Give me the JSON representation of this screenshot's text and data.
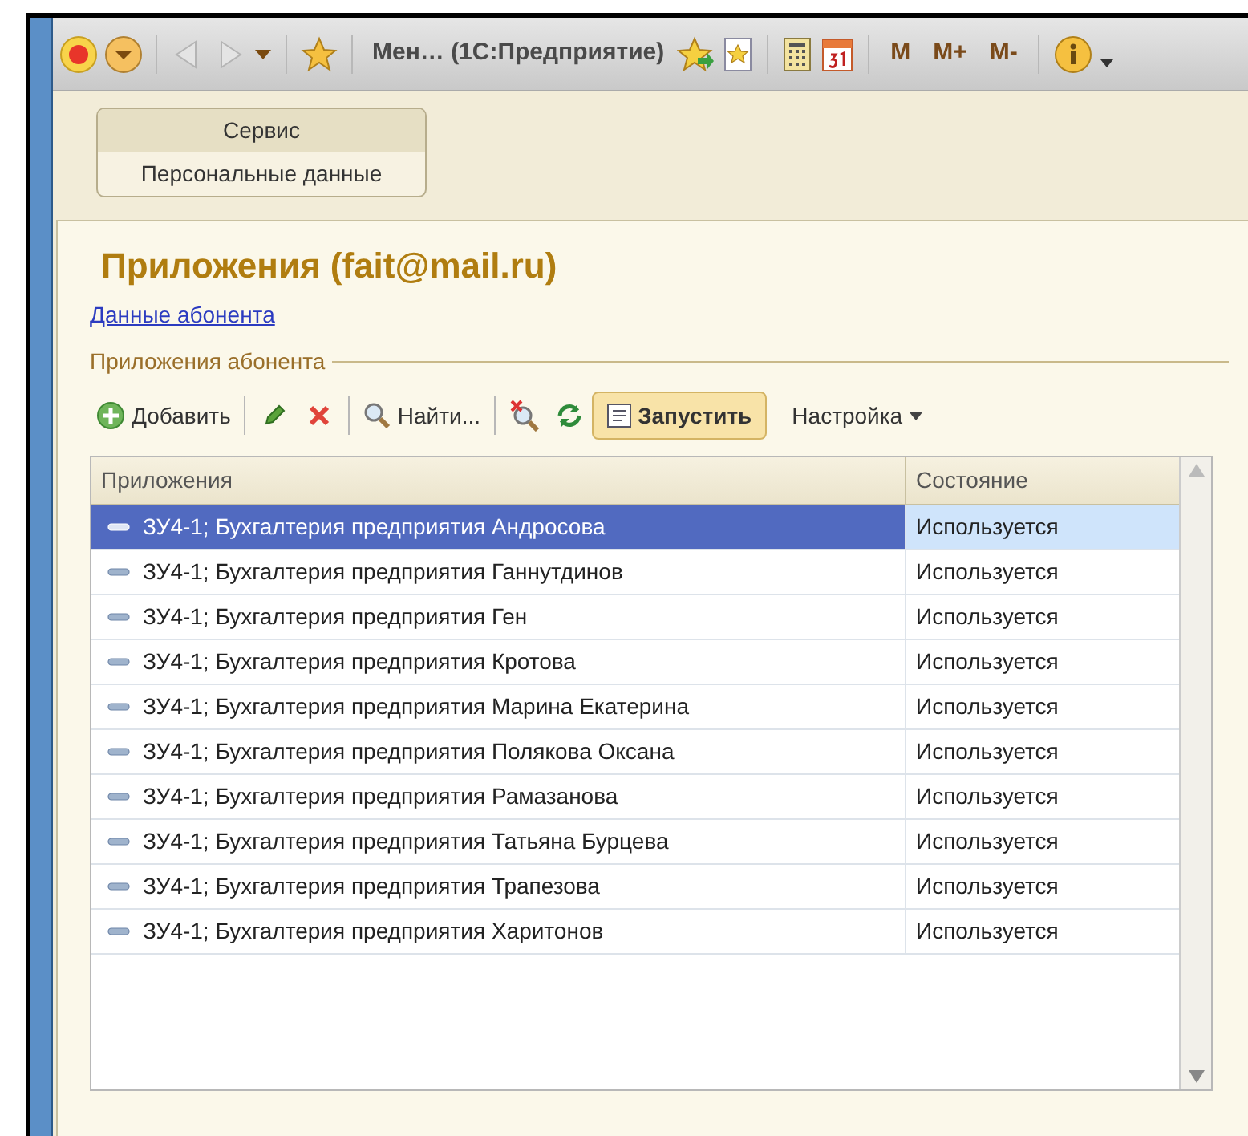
{
  "toolbar": {
    "title": "Мен… (1С:Предприятие)",
    "memory_buttons": [
      "M",
      "M+",
      "M-"
    ]
  },
  "section_panel": {
    "items": [
      {
        "label": "Сервис",
        "selected": true
      },
      {
        "label": "Персональные данные",
        "selected": false
      }
    ]
  },
  "form": {
    "title": "Приложения (fait@mail.ru)",
    "link": "Данные абонента",
    "group_title": "Приложения абонента",
    "commands": [
      {
        "kind": "add",
        "label": "Добавить"
      },
      {
        "kind": "edit"
      },
      {
        "kind": "delete"
      },
      {
        "kind": "find",
        "label": "Найти..."
      },
      {
        "kind": "cancel_find"
      },
      {
        "kind": "refresh"
      },
      {
        "kind": "run",
        "label": "Запустить"
      },
      {
        "kind": "menu",
        "label": "Настройка"
      }
    ]
  },
  "table": {
    "columns": [
      "Приложения",
      "Состояние"
    ],
    "rows": [
      {
        "name": "ЗУ4-1; Бухгалтерия предприятия Андросова",
        "state": "Используется",
        "selected": true
      },
      {
        "name": "ЗУ4-1; Бухгалтерия предприятия Ганнутдинов",
        "state": "Используется",
        "selected": false
      },
      {
        "name": "ЗУ4-1; Бухгалтерия предприятия Ген",
        "state": "Используется",
        "selected": false
      },
      {
        "name": "ЗУ4-1; Бухгалтерия предприятия Кротова",
        "state": "Используется",
        "selected": false
      },
      {
        "name": "ЗУ4-1; Бухгалтерия предприятия Марина Екатерина",
        "state": "Используется",
        "selected": false
      },
      {
        "name": "ЗУ4-1; Бухгалтерия предприятия Полякова Оксана",
        "state": "Используется",
        "selected": false
      },
      {
        "name": "ЗУ4-1; Бухгалтерия предприятия Рамазанова",
        "state": "Используется",
        "selected": false
      },
      {
        "name": "ЗУ4-1; Бухгалтерия предприятия Татьяна Бурцева",
        "state": "Используется",
        "selected": false
      },
      {
        "name": "ЗУ4-1; Бухгалтерия предприятия Трапезова",
        "state": "Используется",
        "selected": false
      },
      {
        "name": "ЗУ4-1; Бухгалтерия предприятия Харитонов",
        "state": "Используется",
        "selected": false
      }
    ]
  }
}
